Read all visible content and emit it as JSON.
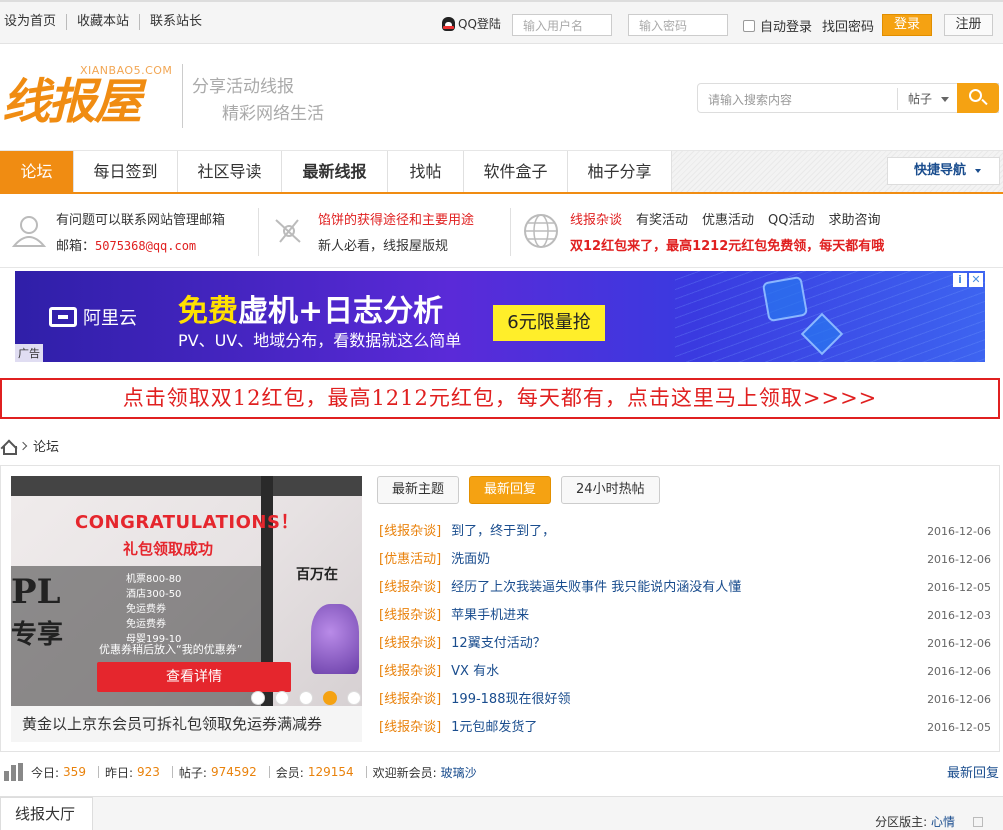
{
  "topbar": {
    "links": [
      "设为首页",
      "收藏本站",
      "联系站长"
    ],
    "qq_login": "QQ登陆",
    "username_placeholder": "输入用户名",
    "password_placeholder": "输入密码",
    "auto_login": "自动登录",
    "find_password": "找回密码",
    "login": "登录",
    "register": "注册"
  },
  "header": {
    "logo_text": "线报屋",
    "logo_en": "XIANBAO5.COM",
    "slogan1": "分享活动线报",
    "slogan2": "精彩网络生活",
    "search_placeholder": "请输入搜索内容",
    "search_type": "帖子"
  },
  "nav": {
    "items": [
      "论坛",
      "每日签到",
      "社区导读",
      "最新线报",
      "找帖",
      "软件盒子",
      "柚子分享"
    ],
    "quick_nav": "快捷导航"
  },
  "info": {
    "contact_line1": "有问题可以联系网站管理邮箱",
    "contact_label": "邮箱：",
    "contact_email": "5075368@qq.com",
    "pie_title": "馅饼的获得途径和主要用途",
    "rules": "新人必看，线报屋版规",
    "cats": [
      "线报杂谈",
      "有奖活动",
      "优惠活动",
      "QQ活动",
      "求助咨询"
    ],
    "hot": "双12红包来了，最高1212元红包免费领，每天都有哦"
  },
  "ad": {
    "brand": "阿里云",
    "headline_yellow": "免费",
    "headline_rest": "虚机+日志分析",
    "subline": "PV、UV、地域分布，看数据就这么简单",
    "cta": "6元限量抢",
    "label": "广告"
  },
  "banner": {
    "text": "点击领取双12红包，最高1212元红包，每天都有，点击这里马上领取>>>>"
  },
  "breadcrumb": {
    "current": "论坛"
  },
  "slider": {
    "title": "CONGRATULATIONS！",
    "subtitle": "礼包领取成功",
    "big": "PL",
    "big2": "专享",
    "lines": [
      "机票800-80",
      "酒店300-50",
      "免运费券",
      "免运费券",
      "母婴199-10"
    ],
    "note": "优惠券稍后放入“我的优惠券”",
    "cta": "查看详情",
    "right_text": "百万在",
    "caption": "黄金以上京东会员可拆礼包领取免运券满减券",
    "active_dot": 3
  },
  "tabs": [
    "最新主题",
    "最新回复",
    "24小时热帖"
  ],
  "threads": [
    {
      "cat": "[线报杂谈]",
      "title": "到了，终于到了，",
      "date": "2016-12-06"
    },
    {
      "cat": "[优惠活动]",
      "title": "洗面奶",
      "date": "2016-12-06"
    },
    {
      "cat": "[线报杂谈]",
      "title": "经历了上次我装逼失败事件 我只能说内涵没有人懂",
      "date": "2016-12-05"
    },
    {
      "cat": "[线报杂谈]",
      "title": "苹果手机进来",
      "date": "2016-12-03"
    },
    {
      "cat": "[线报杂谈]",
      "title": "12翼支付活动？",
      "date": "2016-12-06"
    },
    {
      "cat": "[线报杂谈]",
      "title": "VX 有水",
      "date": "2016-12-06"
    },
    {
      "cat": "[线报杂谈]",
      "title": "199-188现在很好领",
      "date": "2016-12-06"
    },
    {
      "cat": "[线报杂谈]",
      "title": "1元包邮发货了",
      "date": "2016-12-05"
    }
  ],
  "stats": {
    "today_label": "今日:",
    "today": "359",
    "yesterday_label": "昨日:",
    "yesterday": "923",
    "posts_label": "帖子:",
    "posts": "974592",
    "members_label": "会员:",
    "members": "129154",
    "welcome_label": "欢迎新会员:",
    "new_member": "玻璃沙",
    "latest_reply": "最新回复"
  },
  "section": {
    "title": "线报大厅",
    "moderator_label": "分区版主:",
    "moderator": "心情"
  }
}
